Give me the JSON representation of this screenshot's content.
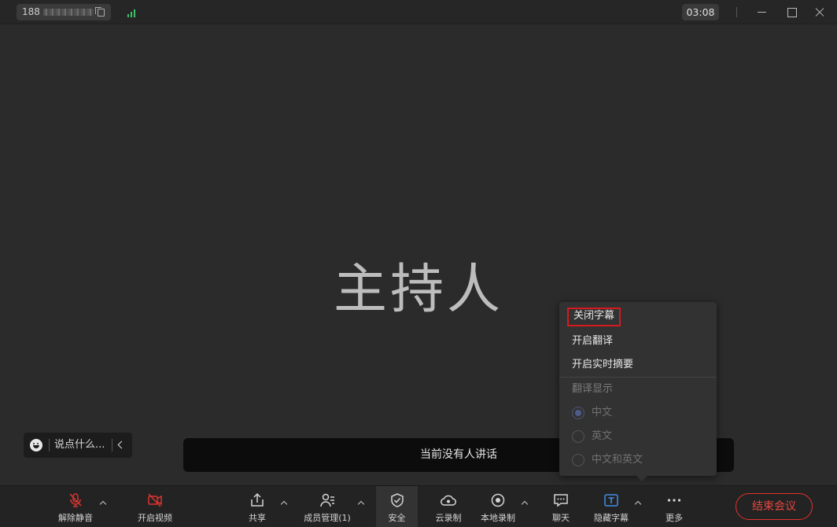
{
  "titlebar": {
    "meeting_id_prefix": "188",
    "timer": "03:08"
  },
  "stage": {
    "host_label": "主持人",
    "chat_placeholder": "说点什么...",
    "speaker_status": "当前没有人讲话"
  },
  "caption_menu": {
    "items": [
      "关闭字幕",
      "开启翻译",
      "开启实时摘要"
    ],
    "section_title": "翻译显示",
    "options": [
      {
        "label": "中文",
        "checked": true
      },
      {
        "label": "英文",
        "checked": false
      },
      {
        "label": "中文和英文",
        "checked": false
      }
    ]
  },
  "toolbar": {
    "unmute": "解除静音",
    "start_video": "开启视频",
    "share": "共享",
    "members": "成员管理(1)",
    "security": "安全",
    "cloud_record": "云录制",
    "local_record": "本地录制",
    "chat": "聊天",
    "captions": "隐藏字幕",
    "more": "更多",
    "end_meeting": "结束会议"
  },
  "colors": {
    "signal": "#3cc46a",
    "danger": "#e0332e",
    "caption_icon": "#3f8fe6"
  }
}
